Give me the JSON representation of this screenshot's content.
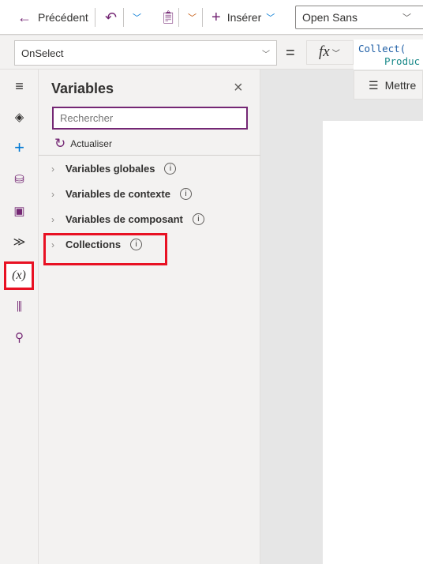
{
  "toolbar": {
    "back": "Précédent",
    "insert": "Insérer",
    "font": "Open Sans"
  },
  "formula": {
    "property": "OnSelect",
    "equals": "=",
    "fx": "fx",
    "code_line1": "Collect(",
    "code_line2": "Produc",
    "format_button": "Mettre"
  },
  "panel": {
    "title": "Variables",
    "search_placeholder": "Rechercher",
    "refresh": "Actualiser",
    "items": [
      {
        "label": "Variables globales"
      },
      {
        "label": "Variables de contexte"
      },
      {
        "label": "Variables de composant"
      },
      {
        "label": "Collections"
      }
    ]
  },
  "colors": {
    "accent": "#742774",
    "highlight": "#e81123"
  }
}
